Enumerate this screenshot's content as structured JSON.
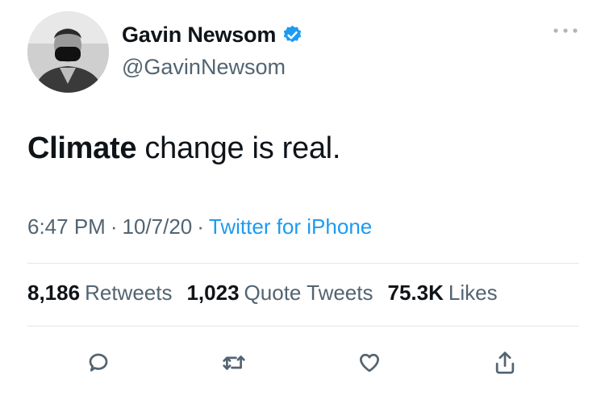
{
  "author": {
    "display_name": "Gavin Newsom",
    "handle": "@GavinNewsom",
    "verified": true,
    "avatar_icon": "profile-photo"
  },
  "tweet": {
    "text_bold": "Climate",
    "text_rest": " change is real."
  },
  "meta": {
    "time": "6:47 PM",
    "date": "10/7/20",
    "source": "Twitter for iPhone",
    "separator": "·"
  },
  "stats": {
    "retweets": {
      "count": "8,186",
      "label": "Retweets"
    },
    "quotes": {
      "count": "1,023",
      "label": "Quote Tweets"
    },
    "likes": {
      "count": "75.3K",
      "label": "Likes"
    }
  },
  "actions": [
    "reply-icon",
    "retweet-icon",
    "like-icon",
    "share-icon"
  ],
  "colors": {
    "text": "#0f1419",
    "secondary": "#536471",
    "link": "#1d9bf0",
    "verified": "#1d9bf0",
    "divider": "#e1e6e9"
  }
}
